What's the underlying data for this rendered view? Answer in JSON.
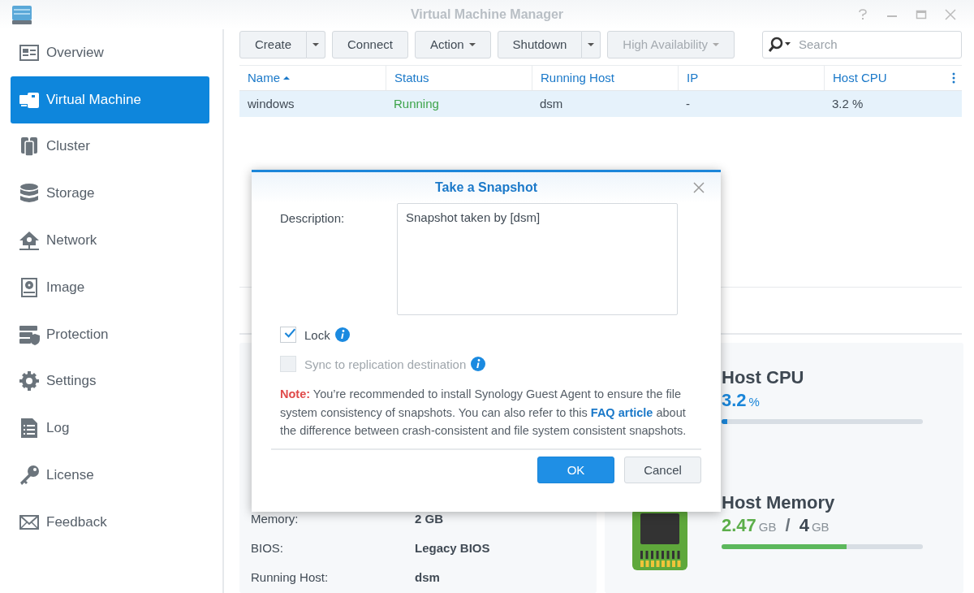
{
  "window": {
    "title": "Virtual Machine Manager"
  },
  "sidebar": {
    "items": [
      {
        "label": "Overview",
        "selected": false
      },
      {
        "label": "Virtual Machine",
        "selected": true
      },
      {
        "label": "Cluster",
        "selected": false
      },
      {
        "label": "Storage",
        "selected": false
      },
      {
        "label": "Network",
        "selected": false
      },
      {
        "label": "Image",
        "selected": false
      },
      {
        "label": "Protection",
        "selected": false
      },
      {
        "label": "Settings",
        "selected": false
      },
      {
        "label": "Log",
        "selected": false
      },
      {
        "label": "License",
        "selected": false
      },
      {
        "label": "Feedback",
        "selected": false
      }
    ]
  },
  "toolbar": {
    "buttons": [
      {
        "label": "Create",
        "kind": "split",
        "disabled": false
      },
      {
        "label": "Connect",
        "kind": "plain",
        "disabled": false
      },
      {
        "label": "Action",
        "kind": "menu",
        "disabled": false
      },
      {
        "label": "Shutdown",
        "kind": "split",
        "disabled": false
      },
      {
        "label": "High Availability",
        "kind": "menu",
        "disabled": true
      }
    ],
    "search": {
      "placeholder": "Search"
    }
  },
  "table": {
    "columns": [
      "Name",
      "Status",
      "Running Host",
      "IP",
      "Host CPU"
    ],
    "rows": [
      {
        "selected": true,
        "cells": [
          "windows",
          "Running",
          "dsm",
          "-",
          "3.2 %"
        ]
      }
    ]
  },
  "details": [
    {
      "label": "Memory:",
      "value": "2 GB"
    },
    {
      "label": "BIOS:",
      "value": "Legacy BIOS"
    },
    {
      "label": "Running Host:",
      "value": "dsm"
    }
  ],
  "host_cpu": {
    "title": "Host CPU",
    "value": "3.2",
    "unit": "%",
    "level": 0.03
  },
  "host_memory": {
    "title": "Host Memory",
    "used": "2.47",
    "used_unit": "GB",
    "separator": "/",
    "total": "4",
    "total_unit": "GB",
    "level": 0.62
  },
  "dialog": {
    "title": "Take a Snapshot",
    "description_label": "Description:",
    "description_value": "Snapshot taken by [dsm]",
    "options": [
      {
        "label": "Lock",
        "checked": true,
        "disabled": false
      },
      {
        "label": "Sync to replication destination",
        "checked": false,
        "disabled": true
      }
    ],
    "note": {
      "label": "Note:",
      "text_before": "You’re recommended to install Synology Guest Agent to ensure the file system consistency of snapshots. You can also refer to this",
      "link": "FAQ article",
      "text_after": "about the difference between crash-consistent and file system consistent snapshots."
    },
    "buttons": [
      {
        "label": "OK",
        "kind": "primary"
      },
      {
        "label": "Cancel",
        "kind": "secondary"
      }
    ]
  }
}
